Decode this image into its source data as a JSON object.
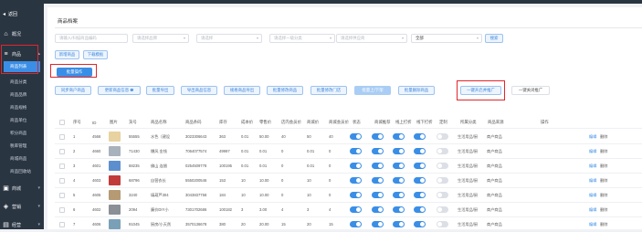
{
  "sidebar": {
    "back": "返回",
    "items": [
      {
        "label": "概况"
      },
      {
        "label": "商品"
      }
    ],
    "subs": [
      "商品列表",
      "商品分类",
      "商品品牌",
      "商品规格",
      "商品单位",
      "积分商品",
      "税率管理",
      "商城商品",
      "商品回收站"
    ],
    "bottom": [
      {
        "label": "商城"
      },
      {
        "label": "营销"
      },
      {
        "label": "经营"
      }
    ]
  },
  "main": {
    "title": "商品档案",
    "filters": {
      "code": "请输入/扫描商品编码",
      "brand": "请选择品牌",
      "type": "请选择",
      "category": "请选择一级分类",
      "supplier": "请选择供应商",
      "status": "全部",
      "search": "搜索"
    },
    "add_buttons": [
      "新增商品",
      "下载模板"
    ],
    "batch_label": "批量操作",
    "actions": [
      "同步商户商品",
      "更新商品信息 ❶",
      "批量导出",
      "导出商品信息",
      "规格商品导出",
      "批量修改商品",
      "批量修改门店",
      "批量上/下架",
      "批量删除商品",
      "一键开启并推广",
      "一键关闭推广"
    ],
    "headers": [
      "序号",
      "ID",
      "图片",
      "货号",
      "商品名称",
      "商品条码",
      "库存",
      "成本价",
      "零售价",
      "店内会员价",
      "商城价",
      "商城会员价",
      "状态",
      "商城推荐",
      "线上打折",
      "线下打折",
      "定制",
      "所属分类",
      "商品来源",
      "操作"
    ],
    "rows": [
      {
        "no": "1",
        "id": "4566",
        "code": "55555",
        "name": "水色（建设",
        "barcode": "3023306643",
        "stock": "363",
        "cost": "0.01",
        "price": "50.00",
        "vip": "40",
        "mall": "50",
        "mallvip": "40",
        "cat": "生活用品/厨",
        "src": "商户商品"
      },
      {
        "no": "2",
        "id": "4660",
        "code": "71430",
        "name": "爆风 金钱",
        "barcode": "7064077574",
        "stock": "49997",
        "cost": "0.01",
        "price": "0.01",
        "vip": "0",
        "mall": "0.01",
        "mallvip": "0",
        "cat": "生活用品/厨",
        "src": "商户商品"
      },
      {
        "no": "3",
        "id": "4601",
        "code": "68235",
        "name": "佛山 连翘",
        "barcode": "0254509778",
        "stock": "100195",
        "cost": "0.01",
        "price": "0.01",
        "vip": "0",
        "mall": "0.01",
        "mallvip": "0",
        "cat": "生活用品/厨",
        "src": "商户商品"
      },
      {
        "no": "4",
        "id": "4603",
        "code": "68796",
        "name": "自营衣长",
        "barcode": "5550200546",
        "stock": "153",
        "cost": "10",
        "price": "10.00",
        "vip": "0",
        "mall": "10",
        "mallvip": "0",
        "cat": "生活用品/厨",
        "src": "商户商品"
      },
      {
        "no": "5",
        "id": "4605",
        "code": "3240",
        "name": "填葫芦304",
        "barcode": "3043837758",
        "stock": "184",
        "cost": "10",
        "price": "10.00",
        "vip": "0",
        "mall": "10",
        "mallvip": "0",
        "cat": "生活用品/厨",
        "src": "商户商品"
      },
      {
        "no": "6",
        "id": "4602",
        "code": "2094",
        "name": "廉价DIY小",
        "barcode": "7301702686",
        "stock": "100182",
        "cost": "3",
        "price": "3.00",
        "vip": "4",
        "mall": "3",
        "mallvip": "4",
        "cat": "生活用品/厨",
        "src": "商户商品"
      },
      {
        "no": "7",
        "id": "4606",
        "code": "91045",
        "name": "厨房/小天然",
        "barcode": "3570136678",
        "stock": "380",
        "cost": "20",
        "price": "20.00",
        "vip": "15",
        "mall": "20",
        "mallvip": "15",
        "cat": "生活用品/厨",
        "src": "商户商品"
      }
    ],
    "row_links": {
      "edit": "编辑",
      "del": "删除"
    }
  },
  "colors": {
    "sidebar": "#2a3542",
    "accent": "#3a8ee6",
    "highlight": "#e0262b"
  }
}
